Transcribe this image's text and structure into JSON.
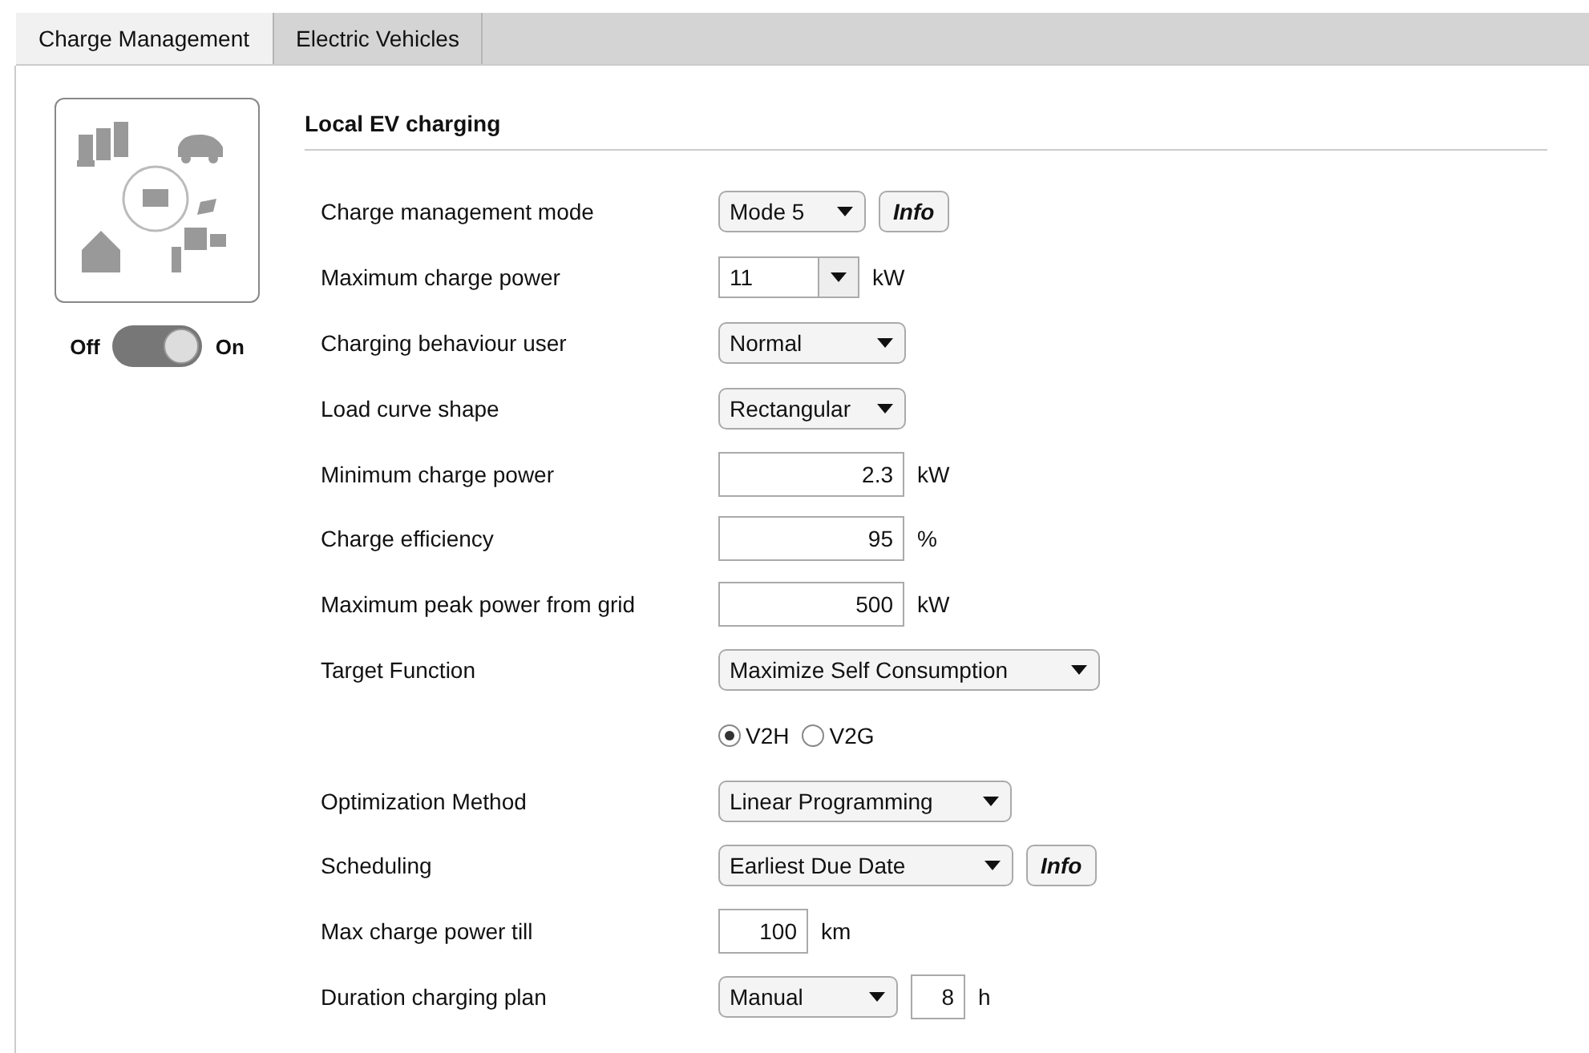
{
  "tabs": [
    {
      "label": "Charge Management",
      "selected": true
    },
    {
      "label": "Electric Vehicles",
      "selected": false
    }
  ],
  "toggle": {
    "off_label": "Off",
    "on_label": "On",
    "on": true
  },
  "section": {
    "title": "Local EV charging"
  },
  "rows": [
    {
      "kind": "select",
      "label": "Charge management mode",
      "value": "Mode 5",
      "info": "Info"
    },
    {
      "kind": "combo",
      "label": "Maximum charge power",
      "value": "11",
      "unit": "kW"
    },
    {
      "kind": "select",
      "label": "Charging behaviour user",
      "value": "Normal"
    },
    {
      "kind": "select",
      "label": "Load curve shape",
      "value": "Rectangular"
    },
    {
      "kind": "number",
      "label": "Minimum charge power",
      "value": "2.3",
      "unit": "kW"
    },
    {
      "kind": "number",
      "label": "Charge efficiency",
      "value": "95",
      "unit": "%"
    },
    {
      "kind": "number",
      "label": "Maximum peak power from grid",
      "value": "500",
      "unit": "kW"
    },
    {
      "kind": "select",
      "label": "Target Function",
      "value": "Maximize Self Consumption"
    },
    {
      "kind": "radios",
      "options": [
        {
          "label": "V2H",
          "selected": true
        },
        {
          "label": "V2G",
          "selected": false
        }
      ]
    },
    {
      "kind": "select",
      "label": "Optimization Method",
      "value": "Linear Programming"
    },
    {
      "kind": "select",
      "label": "Scheduling",
      "value": "Earliest Due Date",
      "info": "Info"
    },
    {
      "kind": "small_number",
      "label": "Max charge power till",
      "value": "100",
      "unit": "km"
    },
    {
      "kind": "select_number",
      "label": "Duration charging plan",
      "value": "Manual",
      "number": "8",
      "unit": "h"
    }
  ]
}
